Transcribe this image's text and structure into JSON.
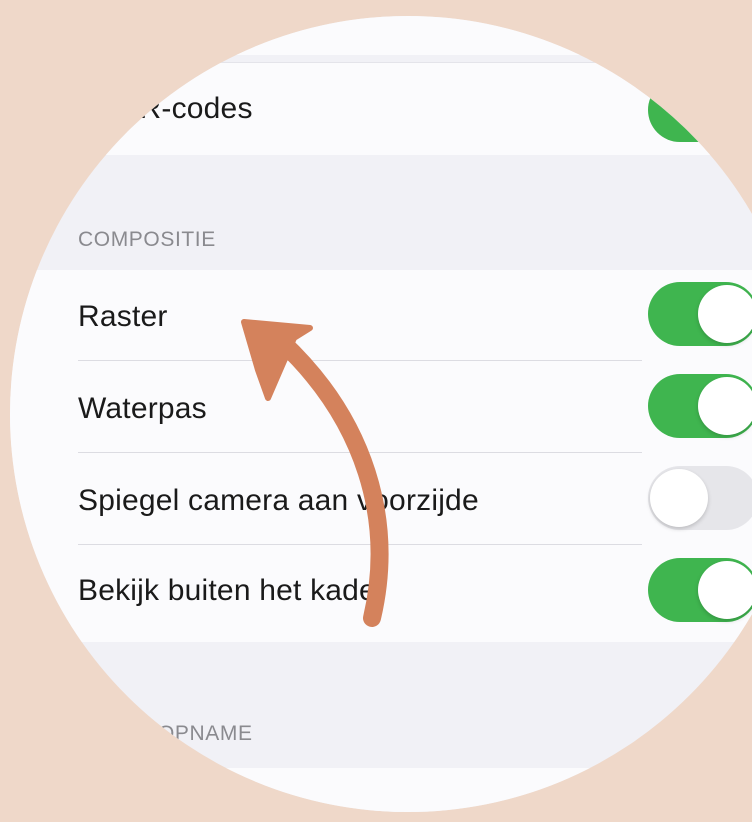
{
  "colors": {
    "background": "#efd8c9",
    "toggle_on": "#3fb54f",
    "toggle_off": "#e6e6ea",
    "arrow": "#d4825c"
  },
  "top_row": {
    "label": "QR-codes",
    "toggle_on": true
  },
  "composition": {
    "header": "COMPOSITIE",
    "rows": [
      {
        "label": "Raster",
        "toggle_on": true
      },
      {
        "label": "Waterpas",
        "toggle_on": true
      },
      {
        "label": "Spiegel camera aan voorzijde",
        "toggle_on": false
      },
      {
        "label": "Bekijk buiten het kader",
        "toggle_on": true
      }
    ]
  },
  "recording": {
    "header": "OPNAME"
  },
  "annotation": {
    "icon": "curved-arrow-icon"
  }
}
